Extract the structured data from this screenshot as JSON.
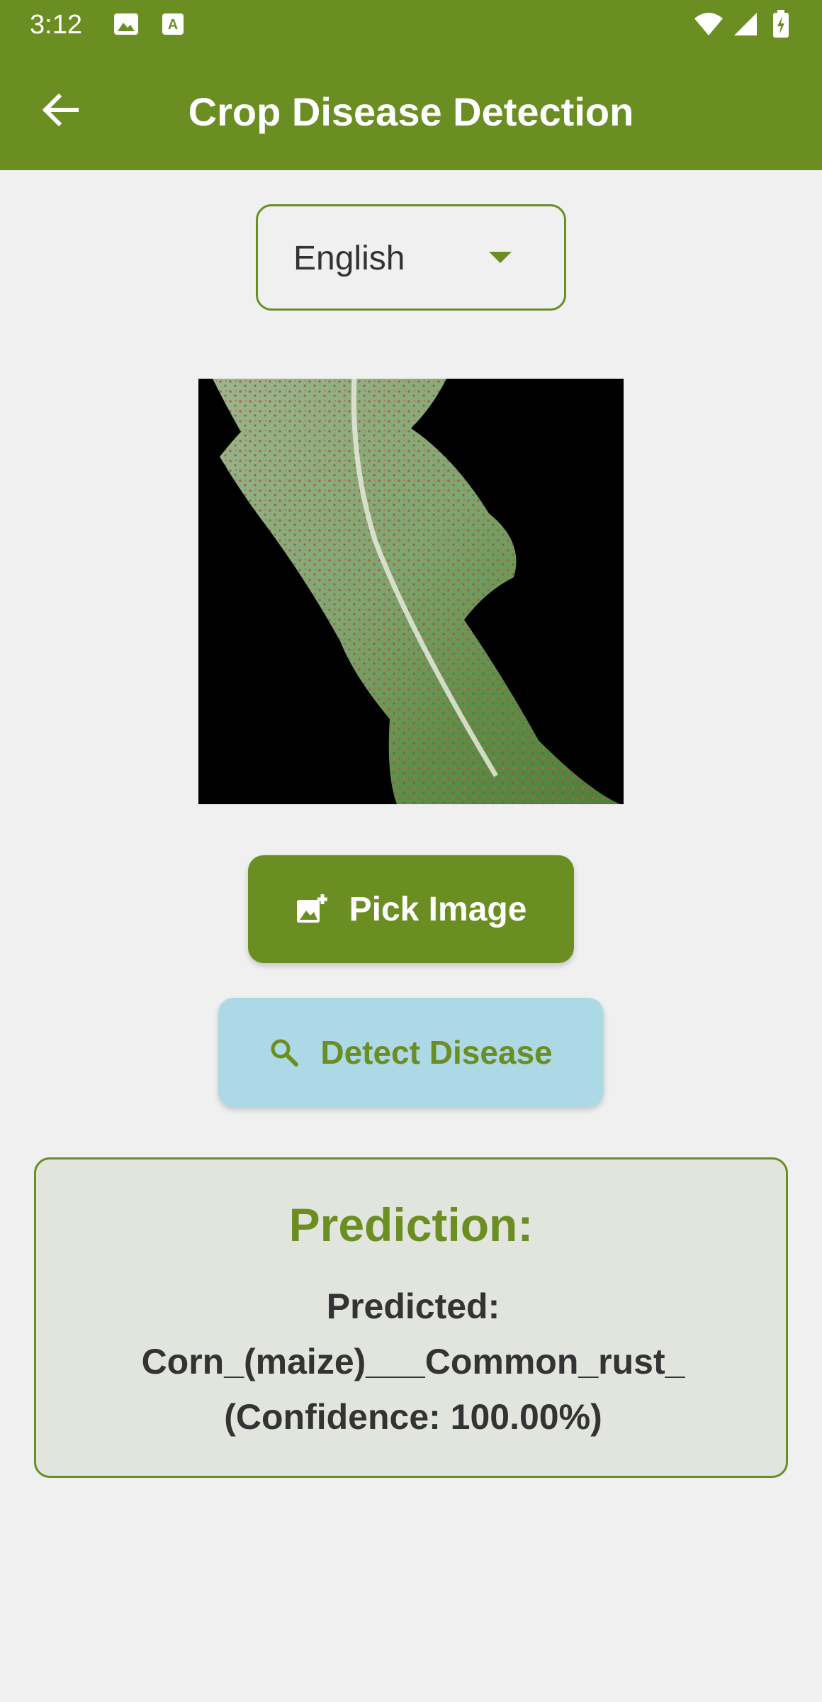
{
  "status_bar": {
    "time": "3:12",
    "icons": [
      "image-icon",
      "a-text-icon",
      "wifi-icon",
      "signal-icon",
      "battery-icon"
    ]
  },
  "app_bar": {
    "title": "Crop Disease Detection",
    "back_icon": "arrow-left-icon"
  },
  "language_select": {
    "value": "English"
  },
  "image": {
    "alt": "Corn leaf"
  },
  "buttons": {
    "pick_image": "Pick Image",
    "pick_image_icon": "add-photo-icon",
    "detect_disease": "Detect Disease",
    "detect_disease_icon": "search-icon"
  },
  "prediction": {
    "heading": "Prediction:",
    "label_line": "Predicted:",
    "class_name": "Corn_(maize)___Common_rust_",
    "confidence_text": "(Confidence: 100.00%)"
  },
  "colors": {
    "primary": "#6b8e23",
    "secondary": "#add8e6",
    "background": "#f0f0f0",
    "card_background": "#e2e5de"
  }
}
